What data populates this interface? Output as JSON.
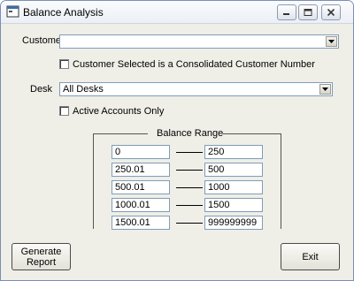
{
  "window": {
    "title": "Balance Analysis"
  },
  "customer": {
    "label": "Customer",
    "value": "",
    "consolidated_label": "Customer Selected is a Consolidated Customer Number",
    "consolidated_checked": false
  },
  "desk": {
    "label": "Desk",
    "value": "All Desks",
    "active_only_label": "Active Accounts Only",
    "active_only_checked": false
  },
  "balance_range": {
    "title": "Balance Range",
    "rows": [
      {
        "from": "0",
        "to": "250"
      },
      {
        "from": "250.01",
        "to": "500"
      },
      {
        "from": "500.01",
        "to": "1000"
      },
      {
        "from": "1000.01",
        "to": "1500"
      },
      {
        "from": "1500.01",
        "to": "999999999"
      }
    ]
  },
  "buttons": {
    "generate_line1": "Generate",
    "generate_line2": "Report",
    "exit": "Exit"
  }
}
